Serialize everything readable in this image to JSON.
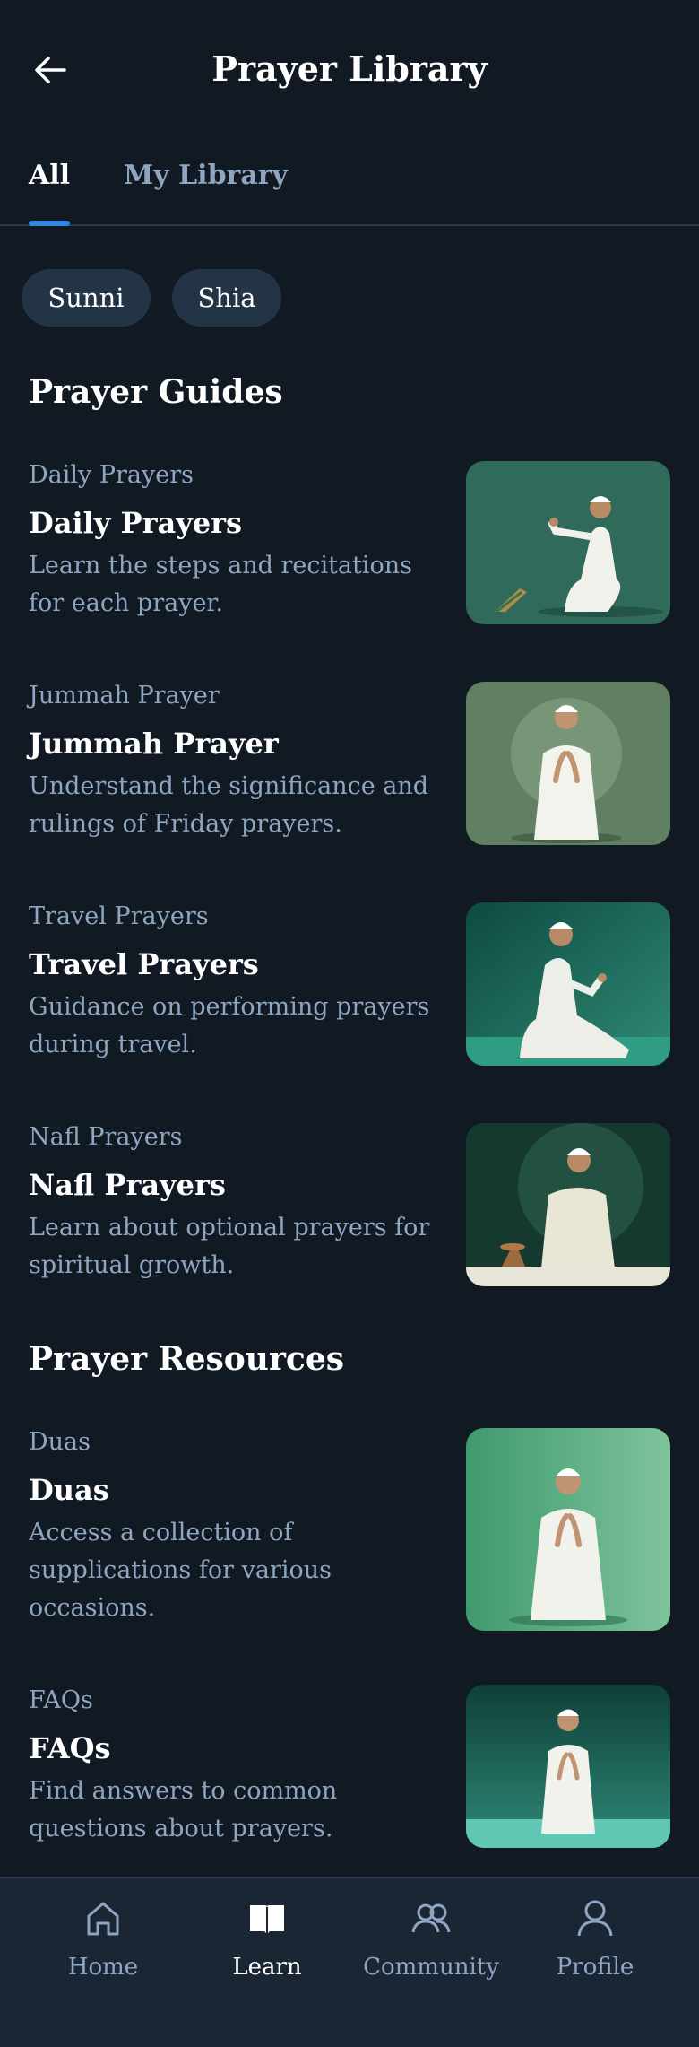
{
  "header": {
    "title": "Prayer Library"
  },
  "tabs": [
    {
      "label": "All"
    },
    {
      "label": "My Library"
    }
  ],
  "filters": [
    {
      "label": "Sunni"
    },
    {
      "label": "Shia"
    }
  ],
  "sections": {
    "guides": {
      "title": "Prayer Guides",
      "items": [
        {
          "category": "Daily Prayers",
          "title": "Daily Prayers",
          "desc_line1": "Learn the steps and recitations",
          "desc_line2": "for each prayer."
        },
        {
          "category": "Jummah Prayer",
          "title": "Jummah Prayer",
          "desc_line1": "Understand the significance and",
          "desc_line2": "rulings of Friday prayers."
        },
        {
          "category": "Travel Prayers",
          "title": "Travel Prayers",
          "desc_line1": "Guidance on performing prayers",
          "desc_line2": "during travel."
        },
        {
          "category": "Nafl Prayers",
          "title": "Nafl Prayers",
          "desc_line1": "Learn about optional prayers for",
          "desc_line2": "spiritual growth."
        }
      ]
    },
    "resources": {
      "title": "Prayer Resources",
      "items": [
        {
          "category": "Duas",
          "title": "Duas",
          "desc_line1": "Access a collection of",
          "desc_line2": "supplications for various",
          "desc_line3": "occasions."
        },
        {
          "category": "FAQs",
          "title": "FAQs",
          "desc_line1": "Find answers to common",
          "desc_line2": "questions about prayers."
        }
      ]
    }
  },
  "bottom_nav": [
    {
      "label": "Home",
      "icon": "home-icon"
    },
    {
      "label": "Learn",
      "icon": "book-icon"
    },
    {
      "label": "Community",
      "icon": "community-icon"
    },
    {
      "label": "Profile",
      "icon": "profile-icon"
    }
  ],
  "colors": {
    "background": "#111923",
    "accent": "#2f86e6",
    "muted_text": "#8fa6c2",
    "chip_bg": "#243447",
    "nav_bg": "#1b2635"
  }
}
